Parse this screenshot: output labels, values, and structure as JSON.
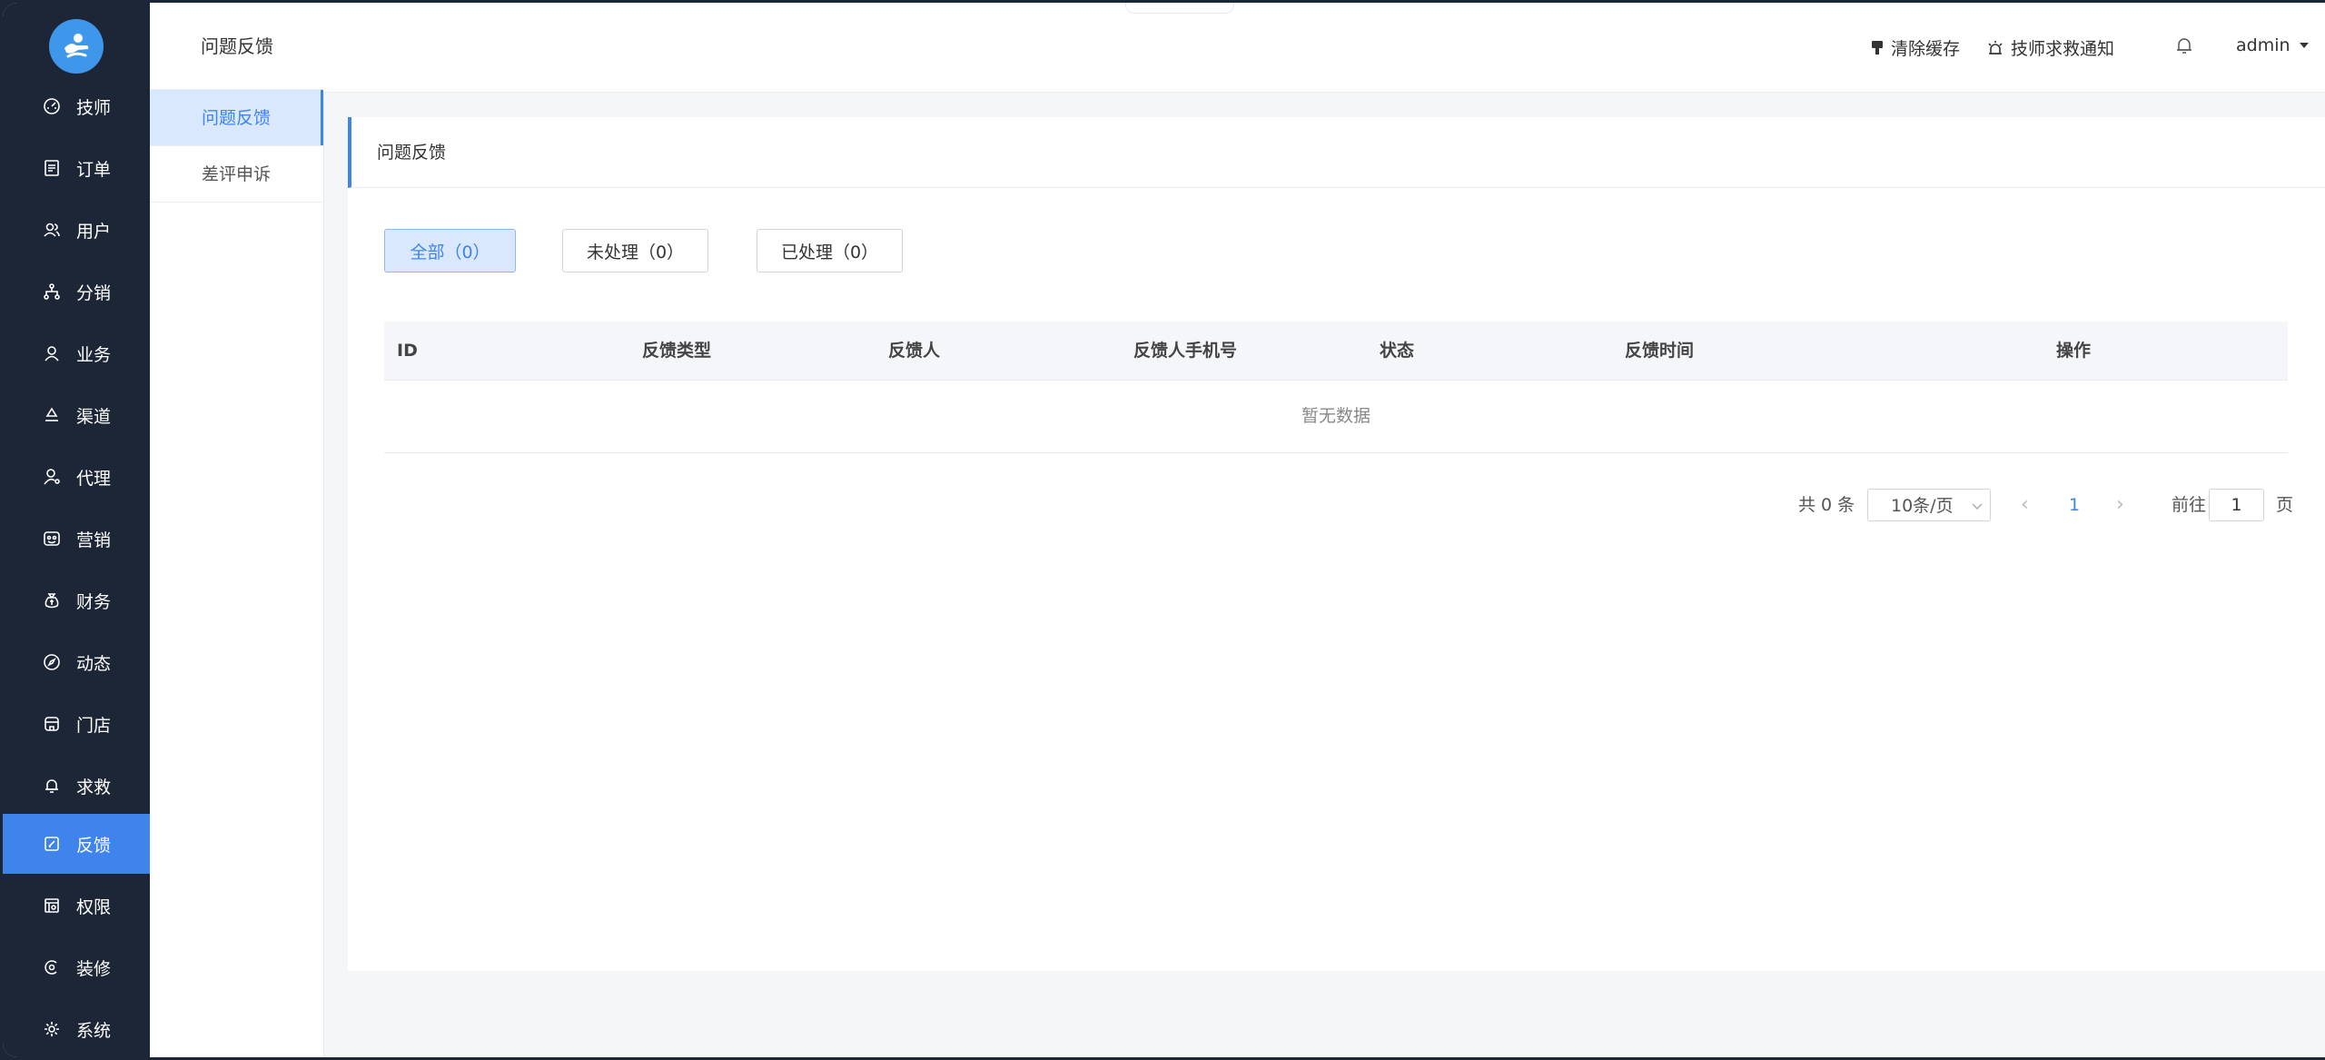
{
  "sidebar": {
    "items": [
      {
        "label": "技师",
        "icon": "dashboard-icon"
      },
      {
        "label": "订单",
        "icon": "document-icon"
      },
      {
        "label": "用户",
        "icon": "users-icon"
      },
      {
        "label": "分销",
        "icon": "hierarchy-icon"
      },
      {
        "label": "业务",
        "icon": "user-icon"
      },
      {
        "label": "渠道",
        "icon": "recycle-icon"
      },
      {
        "label": "代理",
        "icon": "user-settings-icon"
      },
      {
        "label": "营销",
        "icon": "marketing-icon"
      },
      {
        "label": "财务",
        "icon": "money-bag-icon"
      },
      {
        "label": "动态",
        "icon": "compass-icon"
      },
      {
        "label": "门店",
        "icon": "store-icon"
      },
      {
        "label": "求救",
        "icon": "bell-icon"
      },
      {
        "label": "反馈",
        "icon": "feedback-icon",
        "active": true
      },
      {
        "label": "权限",
        "icon": "permission-icon"
      },
      {
        "label": "装修",
        "icon": "palette-icon"
      },
      {
        "label": "系统",
        "icon": "gear-icon"
      }
    ]
  },
  "subnav": {
    "title": "问题反馈",
    "items": [
      {
        "label": "问题反馈",
        "active": true
      },
      {
        "label": "差评申诉"
      }
    ]
  },
  "header": {
    "clear_cache": "清除缓存",
    "sos_notice": "技师求救通知",
    "user": "admin"
  },
  "card": {
    "title": "问题反馈",
    "tabs": [
      {
        "label": "全部（0）",
        "active": true
      },
      {
        "label": "未处理（0）"
      },
      {
        "label": "已处理（0）"
      }
    ]
  },
  "table": {
    "columns": [
      "ID",
      "反馈类型",
      "反馈人",
      "反馈人手机号",
      "状态",
      "反馈时间",
      "操作"
    ],
    "empty_text": "暂无数据"
  },
  "pagination": {
    "total": "共 0 条",
    "page_size": "10条/页",
    "current_page": "1",
    "goto_prefix": "前往",
    "goto_value": "1",
    "goto_suffix": "页"
  },
  "colors": {
    "primary": "#3f84ec",
    "sidebar_bg": "#1c2637"
  }
}
